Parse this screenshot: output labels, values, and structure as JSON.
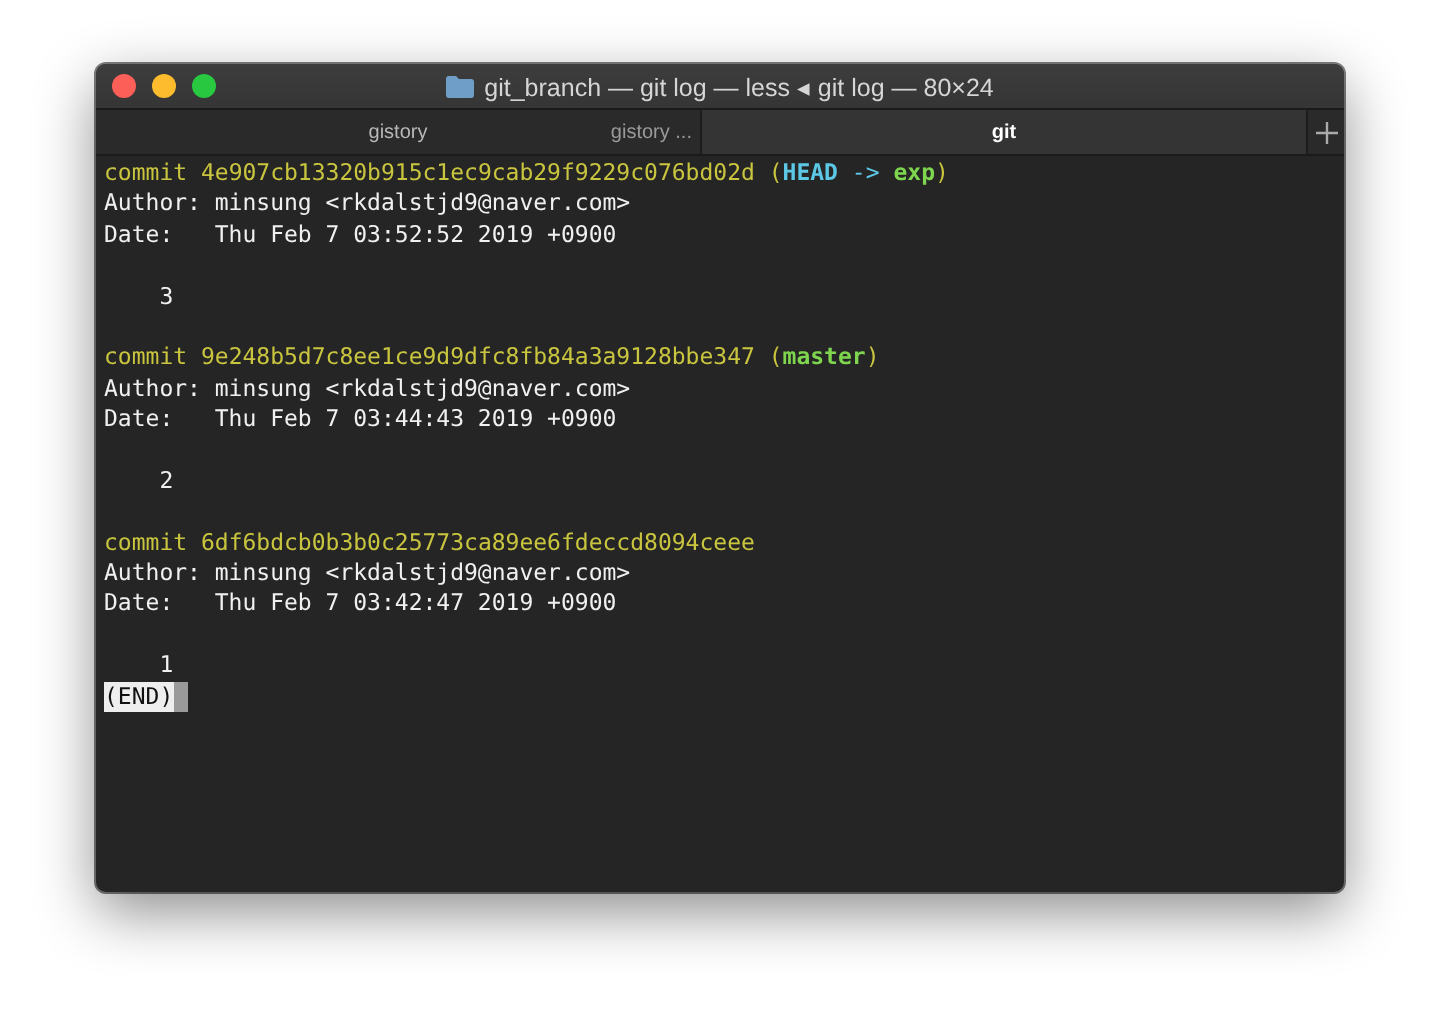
{
  "window": {
    "title": "git_branch — git log — less ◂ git log — 80×24"
  },
  "tabs": [
    {
      "label": "gistory",
      "subtitle": "gistory ...",
      "selected": false
    },
    {
      "label": "git",
      "selected": true
    }
  ],
  "commits": [
    {
      "keyword": "commit",
      "hash": "4e907cb13320b915c1ec9cab29f9229c076bd02d",
      "refs": [
        {
          "kind": "punct",
          "text": "("
        },
        {
          "kind": "head",
          "text": "HEAD"
        },
        {
          "kind": "arrow",
          "text": "->"
        },
        {
          "kind": "branch",
          "text": "exp"
        },
        {
          "kind": "punct",
          "text": ")"
        }
      ],
      "author": "Author: minsung <rkdalstjd9@naver.com>",
      "date": "Date:   Thu Feb 7 03:52:52 2019 +0900",
      "message": "3"
    },
    {
      "keyword": "commit",
      "hash": "9e248b5d7c8ee1ce9d9dfc8fb84a3a9128bbe347",
      "refs": [
        {
          "kind": "punct",
          "text": "("
        },
        {
          "kind": "branch",
          "text": "master"
        },
        {
          "kind": "punct",
          "text": ")"
        }
      ],
      "author": "Author: minsung <rkdalstjd9@naver.com>",
      "date": "Date:   Thu Feb 7 03:44:43 2019 +0900",
      "message": "2"
    },
    {
      "keyword": "commit",
      "hash": "6df6bdcb0b3b0c25773ca89ee6fdeccd8094ceee",
      "author": "Author: minsung <rkdalstjd9@naver.com>",
      "date": "Date:   Thu Feb 7 03:42:47 2019 +0900",
      "message": "1"
    }
  ],
  "pager": {
    "prompt": "(END)"
  }
}
